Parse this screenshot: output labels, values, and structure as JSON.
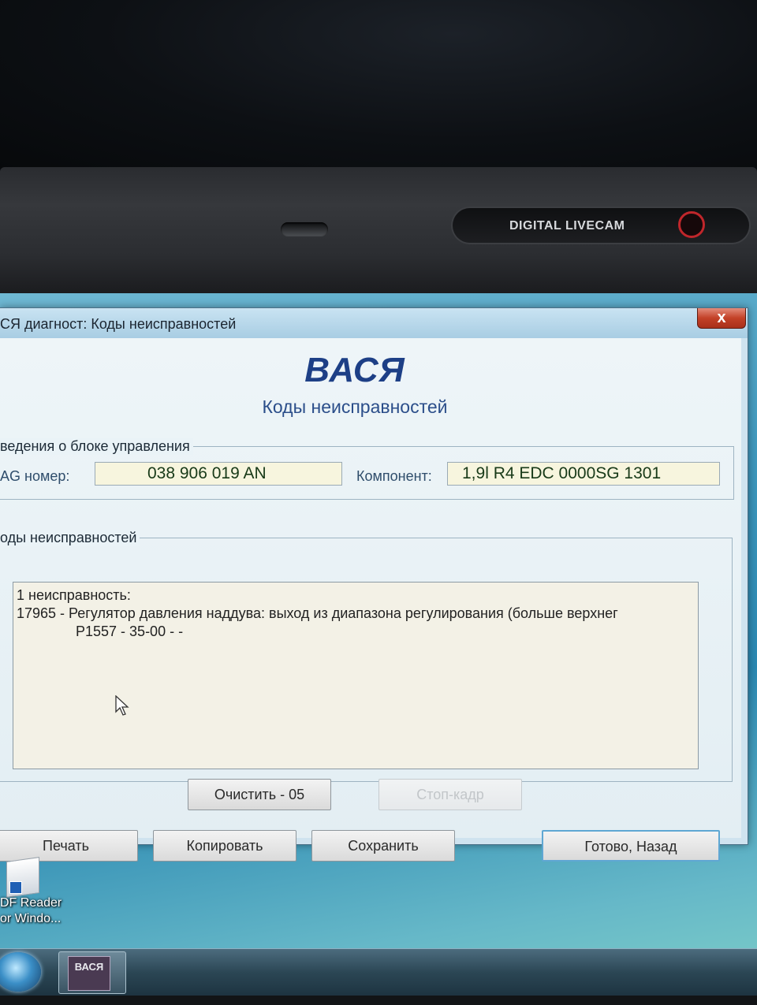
{
  "bezel": {
    "camera_label": "DIGITAL LIVECAM"
  },
  "window": {
    "title": "СЯ диагност: Коды неисправностей",
    "close_label": "x",
    "brand": "ВАСЯ",
    "subtitle": "Коды неисправностей"
  },
  "control_unit": {
    "group_label": "ведения о блоке управления",
    "vag_label": "AG номер:",
    "vag_value": "038 906 019 AN",
    "component_label": "Компонент:",
    "component_value": "1,9l R4 EDC 0000SG  1301"
  },
  "faults": {
    "group_label": "оды неисправностей",
    "lines": [
      "1 неисправность:",
      "17965 -   Регулятор давления наддува: выход из диапазона регулирования (больше верхнег",
      "P1557 - 35-00 -   -"
    ]
  },
  "buttons": {
    "clear": "Очистить - 05",
    "freeze_frame": "Стоп-кадр",
    "print": "Печать",
    "copy": "Копировать",
    "save": "Сохранить",
    "done_back": "Готово, Назад"
  },
  "desktop": {
    "icon_label_line1": "DF Reader",
    "icon_label_line2": "or Windo..."
  },
  "taskbar": {
    "app_icon_text": "ВАСЯ"
  }
}
